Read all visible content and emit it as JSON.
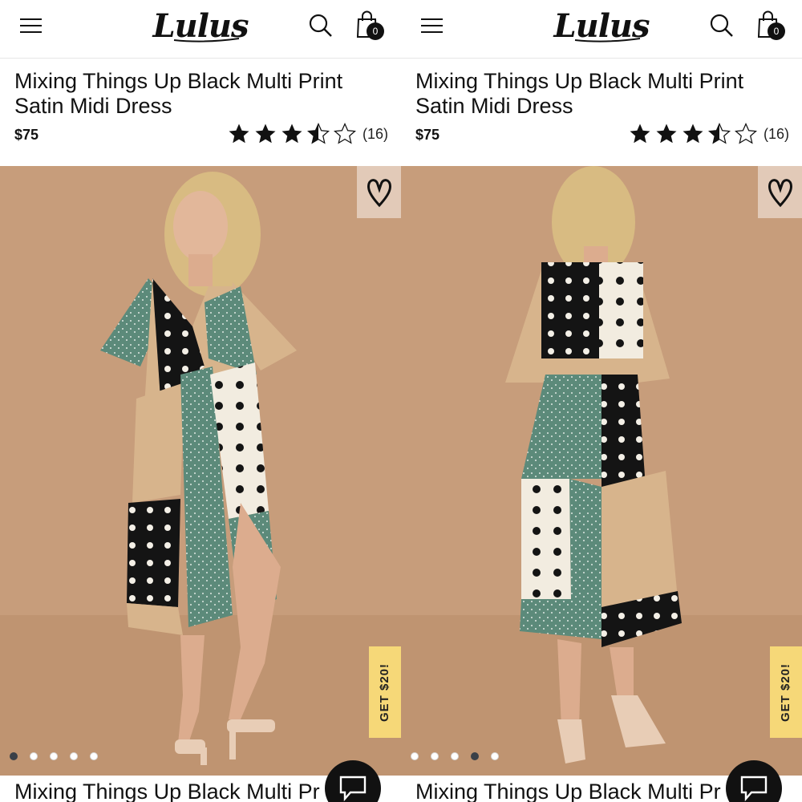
{
  "brand": {
    "logo_text": "Lulus"
  },
  "header": {
    "menu_icon": "hamburger-menu-icon",
    "search_icon": "search-icon",
    "cart_icon": "shopping-bag-icon",
    "cart_count": "0"
  },
  "product": {
    "title": "Mixing Things Up Black Multi Print Satin Midi Dress",
    "price": "$75",
    "rating": 3.5,
    "rating_max": 5,
    "review_count": "(16)"
  },
  "promo": {
    "label": "GET $20!",
    "color": "#f6d878"
  },
  "panels": [
    {
      "view": "front",
      "carousel": {
        "total": 5,
        "active_index": 0
      },
      "bottom_title_visible": "Mixing Things Up Black Multi Pr"
    },
    {
      "view": "back",
      "carousel": {
        "total": 5,
        "active_index": 3
      },
      "bottom_title_visible": "Mixing Things Up Black Multi Pr"
    }
  ],
  "icons": {
    "wishlist": "heart-icon",
    "chat": "chat-bubble-icon",
    "star": "star-icon"
  },
  "colors": {
    "photo_background": "#c79d7b",
    "text": "#111111",
    "badge": "#111111"
  }
}
